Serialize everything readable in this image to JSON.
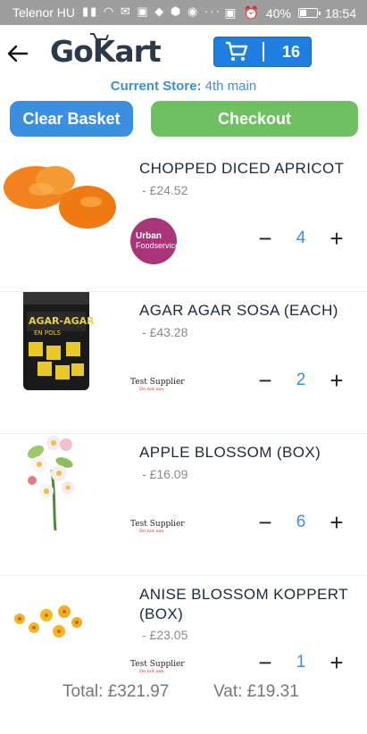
{
  "status_bar": {
    "carrier": "Telenor HU",
    "battery": "40%",
    "time": "18:54",
    "battery_level": 0.4
  },
  "header": {
    "logo": "GoKart",
    "cart_count": "16"
  },
  "store": {
    "label": "Current Store:",
    "value": "4th main"
  },
  "actions": {
    "clear": "Clear Basket",
    "checkout": "Checkout"
  },
  "items": [
    {
      "name": "CHOPPED DICED APRICOT",
      "price": "- £24.52",
      "supplier_line1": "Urban",
      "supplier_line2": "Foodservice",
      "quantity": "4"
    },
    {
      "name": "AGAR AGAR SOSA (EACH)",
      "price": "- £43.28",
      "supplier_line1": "Test Supplier",
      "supplier_line2": "Do not use",
      "quantity": "2",
      "jar_label": "AGAR-AGAR",
      "jar_sublabel": "EN POLS"
    },
    {
      "name": "APPLE BLOSSOM  (BOX)",
      "price": "- £16.09",
      "supplier_line1": "Test Supplier",
      "supplier_line2": "Do not use",
      "quantity": "6"
    },
    {
      "name": "ANISE BLOSSOM KOPPERT (BOX)",
      "price": "- £23.05",
      "supplier_line1": "Test Supplier",
      "supplier_line2": "Do not use",
      "quantity": "1"
    }
  ],
  "totals": {
    "total": "Total: £321.97",
    "vat": "Vat: £19.31"
  },
  "colors": {
    "accent_blue": "#1e7fe0",
    "clear_button": "#3a8fe0",
    "checkout_button": "#6ec060"
  }
}
